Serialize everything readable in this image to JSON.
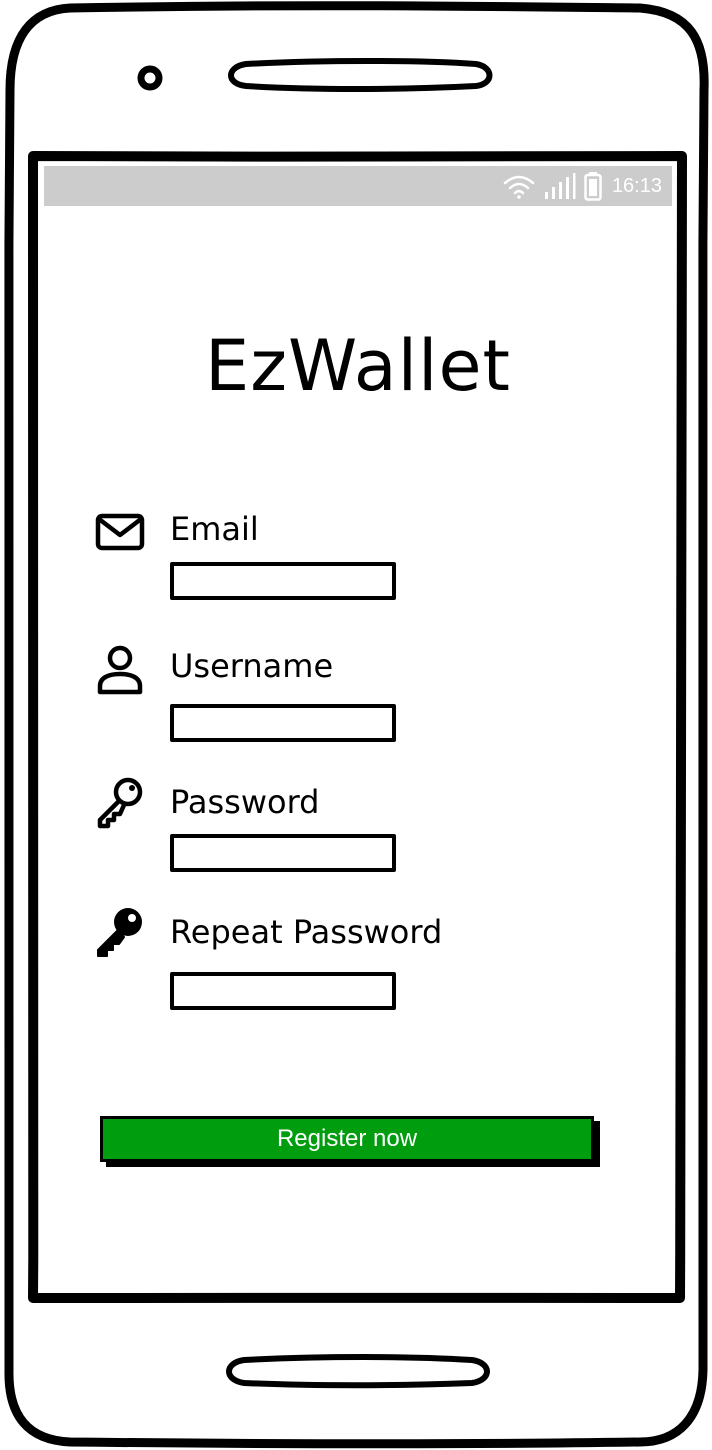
{
  "status_bar": {
    "time": "16:13",
    "icons": [
      "wifi-icon",
      "signal-icon",
      "battery-icon"
    ],
    "background": "#cccccc"
  },
  "app": {
    "title": "EzWallet"
  },
  "form": {
    "fields": [
      {
        "label": "Email",
        "icon": "envelope-icon",
        "value": "",
        "placeholder": ""
      },
      {
        "label": "Username",
        "icon": "user-icon",
        "value": "",
        "placeholder": ""
      },
      {
        "label": "Password",
        "icon": "key-outline-icon",
        "value": "",
        "placeholder": ""
      },
      {
        "label": "Repeat Password",
        "icon": "key-solid-icon",
        "value": "",
        "placeholder": ""
      }
    ],
    "submit_label": "Register now",
    "submit_color": "#009e0f"
  }
}
